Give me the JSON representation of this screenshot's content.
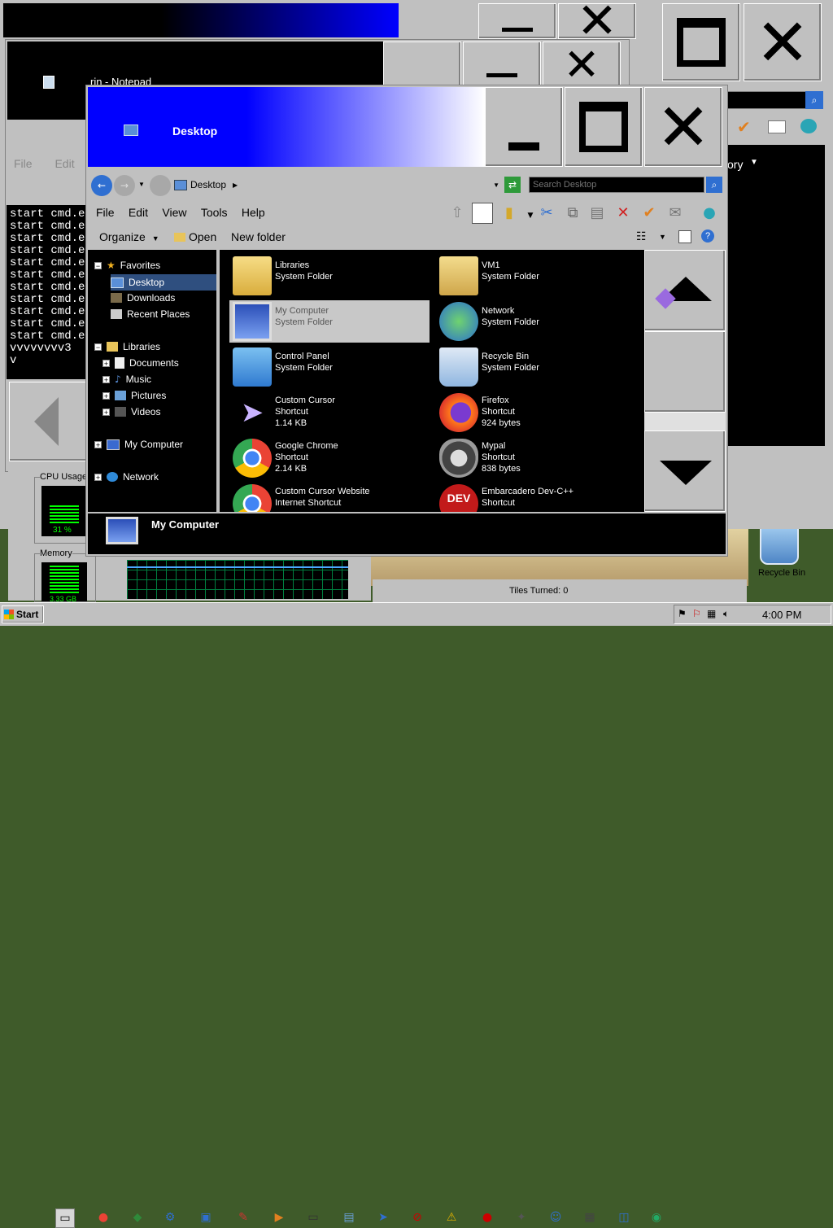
{
  "back_window": {
    "title": "",
    "toolbar_right": "ory"
  },
  "notepad": {
    "title": "rin - Notepad",
    "menu": [
      "File",
      "Edit",
      "F"
    ]
  },
  "cmd": {
    "lines": [
      "start cmd.ex",
      "start cmd.ex",
      "start cmd.ex",
      "start cmd.ex",
      "start cmd.ex",
      "start cmd.ex",
      "start cmd.ex",
      "start cmd.ex",
      "start cmd.ex",
      "start cmd.ex",
      "start cmd.ex",
      "vvvvvvvv3",
      "v"
    ]
  },
  "taskmgr": {
    "cpu_label": "CPU Usage",
    "cpu_value": "31 %",
    "cpu_level": 0.31,
    "mem_label": "Memory",
    "mem_value": "3.33 GB"
  },
  "game": {
    "status": "Tiles Turned: 0"
  },
  "desktop_icon": {
    "label": "Recycle Bin"
  },
  "explorer": {
    "title": "Desktop",
    "address": "Desktop",
    "search_placeholder": "Search Desktop",
    "menu": [
      "File",
      "Edit",
      "View",
      "Tools",
      "Help"
    ],
    "commands": {
      "organize": "Organize",
      "open": "Open",
      "new_folder": "New folder"
    },
    "nav": {
      "favorites": "Favorites",
      "desktop": "Desktop",
      "downloads": "Downloads",
      "recent": "Recent Places",
      "libraries": "Libraries",
      "documents": "Documents",
      "music": "Music",
      "pictures": "Pictures",
      "videos": "Videos",
      "computer": "My Computer",
      "network": "Network"
    },
    "items": [
      {
        "name": "Libraries",
        "l2": "System Folder",
        "l3": "",
        "icon": "libraries-icon"
      },
      {
        "name": "VM1",
        "l2": "System Folder",
        "l3": "",
        "icon": "user-folder-icon"
      },
      {
        "name": "My Computer",
        "l2": "System Folder",
        "l3": "",
        "icon": "computer-icon"
      },
      {
        "name": "Network",
        "l2": "System Folder",
        "l3": "",
        "icon": "network-icon"
      },
      {
        "name": "Control Panel",
        "l2": "System Folder",
        "l3": "",
        "icon": "control-panel-icon"
      },
      {
        "name": "Recycle Bin",
        "l2": "System Folder",
        "l3": "",
        "icon": "recycle-bin-icon"
      },
      {
        "name": "Custom Cursor",
        "l2": "Shortcut",
        "l3": "1.14 KB",
        "icon": "cursor-icon"
      },
      {
        "name": "Firefox",
        "l2": "Shortcut",
        "l3": "924 bytes",
        "icon": "firefox-icon"
      },
      {
        "name": "Google Chrome",
        "l2": "Shortcut",
        "l3": "2.14 KB",
        "icon": "chrome-icon"
      },
      {
        "name": "Mypal",
        "l2": "Shortcut",
        "l3": "838 bytes",
        "icon": "mypal-icon"
      },
      {
        "name": "Custom Cursor Website",
        "l2": "Internet Shortcut",
        "l3": "",
        "icon": "chrome-icon"
      },
      {
        "name": "Embarcadero Dev-C++",
        "l2": "Shortcut",
        "l3": "",
        "icon": "devcpp-icon"
      }
    ],
    "details_name": "My Computer"
  },
  "taskbar": {
    "start": "Start",
    "clock": "4:00 PM"
  },
  "colors": {
    "title_blue": "#0000ff",
    "selection": "#c8c8c8",
    "panel": "#000000"
  }
}
